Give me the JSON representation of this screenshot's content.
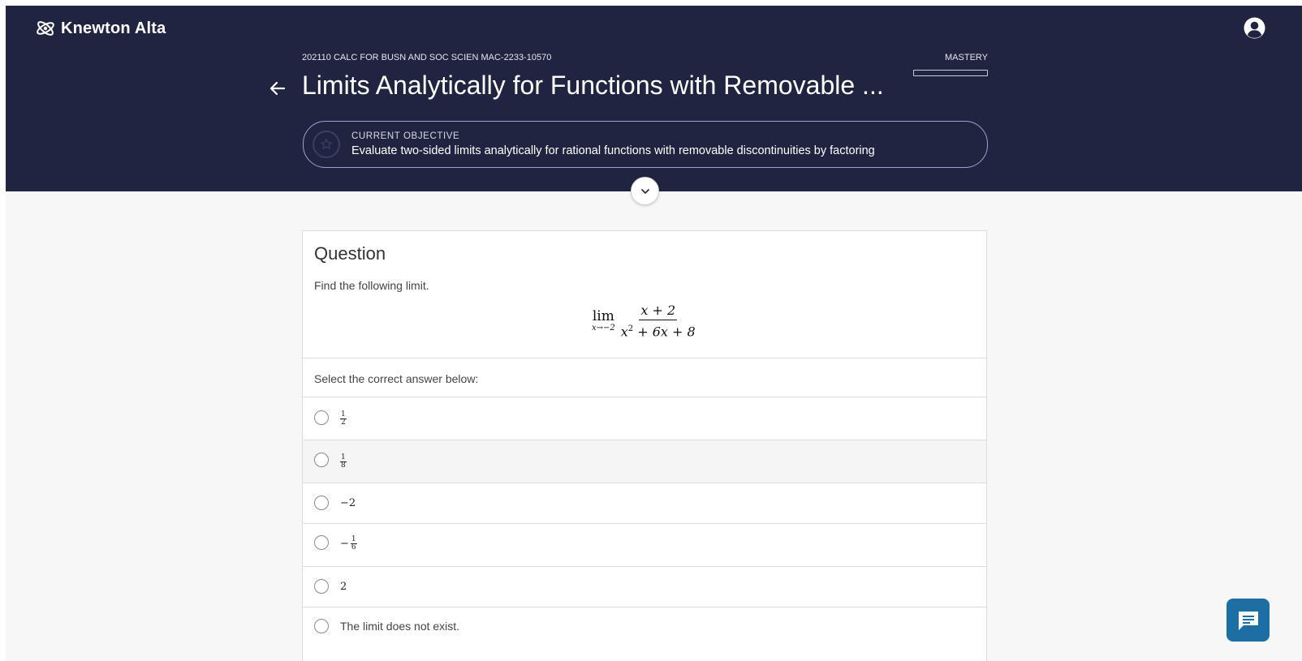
{
  "app": {
    "name": "Knewton Alta"
  },
  "header": {
    "course": "202110 CALC FOR BUSN AND SOC SCIEN MAC-2233-10570",
    "mastery_label": "MASTERY",
    "mastery_progress": 0,
    "title": "Limits Analytically for Functions with Removable ...",
    "objective": {
      "label": "CURRENT OBJECTIVE",
      "text": "Evaluate two-sided limits analytically for rational functions with removable discontinuities by factoring"
    }
  },
  "question": {
    "heading": "Question",
    "prompt": "Find the following limit.",
    "formula": {
      "lim": "lim",
      "subscript": "x→−2",
      "numerator": "x + 2",
      "denominator_base": "x",
      "denominator_exp": "2",
      "denominator_rest": " + 6x + 8"
    },
    "select_label": "Select the correct answer below:",
    "options": [
      {
        "num": "1",
        "den": "2"
      },
      {
        "num": "1",
        "den": "8"
      },
      {
        "text": "−2"
      },
      {
        "sign": "−",
        "num": "1",
        "den": "6"
      },
      {
        "text": "2"
      },
      {
        "text": "The limit does not exist."
      }
    ],
    "highlighted_option": 2
  },
  "icons": {
    "logo": "knewton-atom-icon",
    "user": "user-circle-icon",
    "back": "arrow-left-icon",
    "objective": "star-icon",
    "toggle": "chevron-down-icon",
    "chat": "chat-bubble-icon"
  },
  "colors": {
    "header_bg": "#212440",
    "page_bg": "#f7f7f7",
    "objective_border": "#9da2d6",
    "chat_button": "#1d6fa3"
  }
}
